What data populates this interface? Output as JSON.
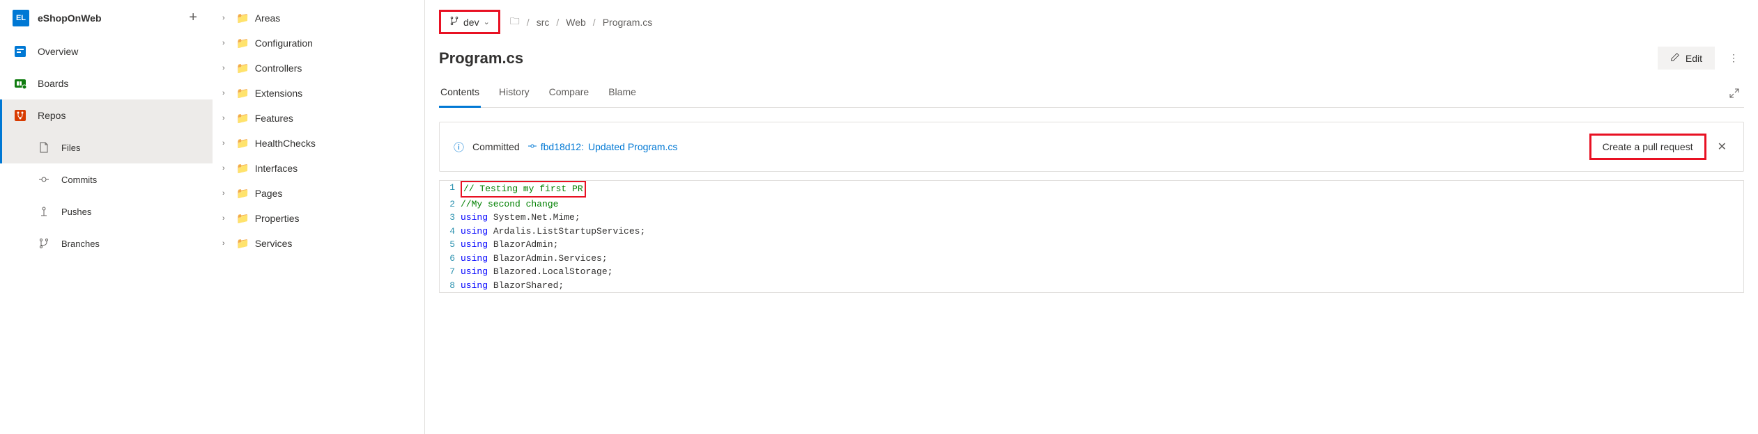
{
  "project": {
    "icon": "EL",
    "name": "eShopOnWeb"
  },
  "sidebar": {
    "overview": "Overview",
    "boards": "Boards",
    "repos": "Repos",
    "files": "Files",
    "commits": "Commits",
    "pushes": "Pushes",
    "branches": "Branches"
  },
  "tree": {
    "items": [
      "Areas",
      "Configuration",
      "Controllers",
      "Extensions",
      "Features",
      "HealthChecks",
      "Interfaces",
      "Pages",
      "Properties",
      "Services"
    ]
  },
  "branch": {
    "name": "dev"
  },
  "breadcrumb": {
    "root": "/",
    "p1": "src",
    "p2": "Web",
    "file": "Program.cs"
  },
  "title": "Program.cs",
  "edit": "Edit",
  "tabs": {
    "contents": "Contents",
    "history": "History",
    "compare": "Compare",
    "blame": "Blame"
  },
  "commit": {
    "status": "Committed",
    "hash": "fbd18d12:",
    "msg": "Updated Program.cs",
    "pr_button": "Create a pull request"
  },
  "code": {
    "l1": "// Testing my first PR",
    "l2": "//My second change",
    "l3a": "using",
    "l3b": " System.Net.Mime;",
    "l4a": "using",
    "l4b": " Ardalis.ListStartupServices;",
    "l5a": "using",
    "l5b": " BlazorAdmin;",
    "l6a": "using",
    "l6b": " BlazorAdmin.Services;",
    "l7a": "using",
    "l7b": " Blazored.LocalStorage;",
    "l8a": "using",
    "l8b": " BlazorShared;"
  }
}
